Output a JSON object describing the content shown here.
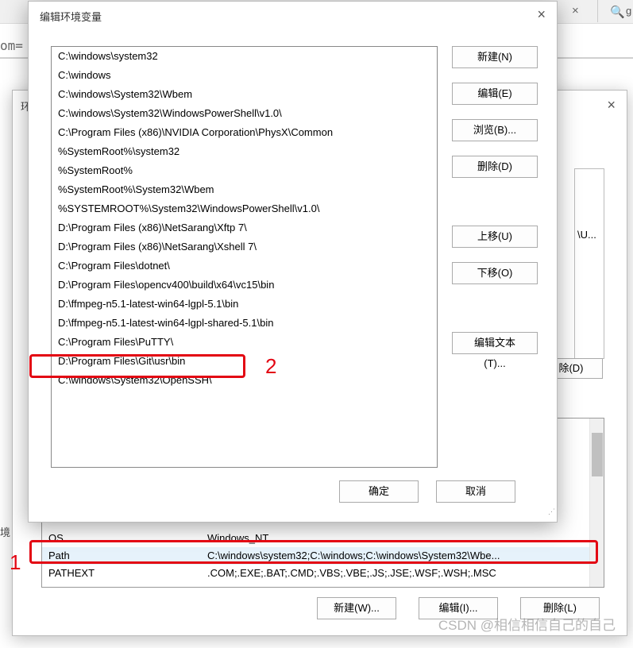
{
  "background": {
    "close_x": "×",
    "search_glyph": "🔍",
    "search_letter": "g",
    "om_text": "om="
  },
  "sysvar": {
    "env_label_fragment": "环",
    "close_x": "×",
    "upper_item": "\\U...",
    "upper_del": "除(D)",
    "env_label_2": "境",
    "rows": [
      {
        "name": "OS",
        "value": "Windows_NT"
      },
      {
        "name": "Path",
        "value": "C:\\windows\\system32;C:\\windows;C:\\windows\\System32\\Wbe..."
      },
      {
        "name": "PATHEXT",
        "value": ".COM;.EXE;.BAT;.CMD;.VBS;.VBE;.JS;.JSE;.WSF;.WSH;.MSC"
      },
      {
        "name": "",
        "value": ""
      }
    ],
    "selected_row": 1,
    "buttons": {
      "new": "新建(W)...",
      "edit": "编辑(I)...",
      "delete": "删除(L)"
    }
  },
  "edit": {
    "title": "编辑环境变量",
    "close_x": "×",
    "items": [
      "C:\\windows\\system32",
      "C:\\windows",
      "C:\\windows\\System32\\Wbem",
      "C:\\windows\\System32\\WindowsPowerShell\\v1.0\\",
      "C:\\Program Files (x86)\\NVIDIA Corporation\\PhysX\\Common",
      "%SystemRoot%\\system32",
      "%SystemRoot%",
      "%SystemRoot%\\System32\\Wbem",
      "%SYSTEMROOT%\\System32\\WindowsPowerShell\\v1.0\\",
      "D:\\Program Files (x86)\\NetSarang\\Xftp 7\\",
      "D:\\Program Files (x86)\\NetSarang\\Xshell 7\\",
      "C:\\Program Files\\dotnet\\",
      "D:\\Program Files\\opencv400\\build\\x64\\vc15\\bin",
      "D:\\ffmpeg-n5.1-latest-win64-lgpl-5.1\\bin",
      "D:\\ffmpeg-n5.1-latest-win64-lgpl-shared-5.1\\bin",
      "C:\\Program Files\\PuTTY\\",
      "D:\\Program Files\\Git\\usr\\bin",
      "C:\\windows\\System32\\OpenSSH\\"
    ],
    "buttons": {
      "new": "新建(N)",
      "edit": "编辑(E)",
      "browse": "浏览(B)...",
      "delete": "删除(D)",
      "up": "上移(U)",
      "down": "下移(O)",
      "edit_text": "编辑文本(T)...",
      "ok": "确定",
      "cancel": "取消"
    }
  },
  "annotation": {
    "label1": "1",
    "label2": "2"
  },
  "watermark": "CSDN @相信相信自己的自己"
}
